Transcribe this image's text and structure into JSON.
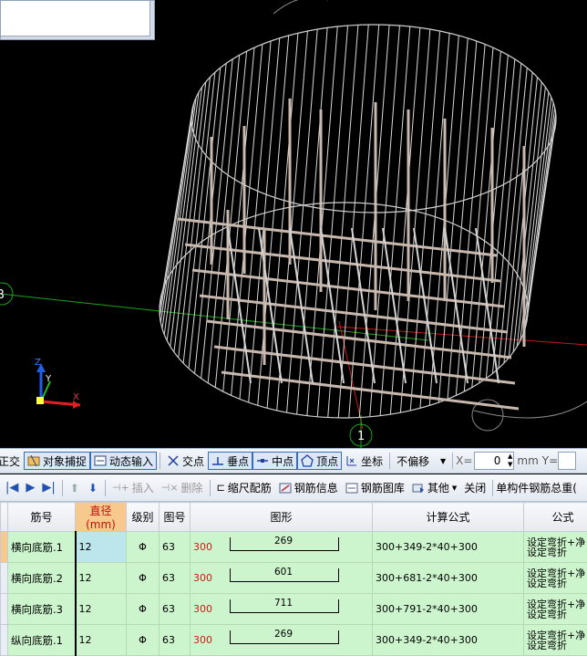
{
  "viewport": {
    "axis_labels": {
      "b": "B",
      "one": "1",
      "x": "X",
      "y": "Y",
      "z": "Z"
    },
    "colors": {
      "background": "#000000",
      "rebar": "#c8b8ae",
      "mesh": "#d4d4d4",
      "axis_green": "#1aa51a",
      "axis_red": "#c81818"
    }
  },
  "toolbar1": {
    "cut_label": "正交",
    "snap_label": "对象捕捉",
    "dynamic_label": "动态输入",
    "intersection_label": "交点",
    "perpendicular_label": "垂点",
    "midpoint_label": "中点",
    "vertex_label": "顶点",
    "coord_label": "坐标",
    "offset_select": "不偏移",
    "x_label": "X=",
    "x_value": "0",
    "unit_label": "mm",
    "y_label": "Y="
  },
  "toolbar2": {
    "insert_label": "插入",
    "delete_label": "删除",
    "scale_label": "缩尺配筋",
    "info_label": "钢筋信息",
    "library_label": "钢筋图库",
    "other_label": "其他",
    "close_label": "关闭",
    "summary_label": "单构件钢筋总重("
  },
  "grid": {
    "headers": [
      "筋号",
      "直径(mm)",
      "级别",
      "图号",
      "图形",
      "计算公式",
      "公式"
    ],
    "rows": [
      {
        "name": "横向底筋.1",
        "diameter": "12",
        "grade": "Φ",
        "fig": "63",
        "left": "300",
        "length": "269",
        "formula": "300+349-2*40+300",
        "desc1": "设定弯折+净",
        "desc2": "设定弯折"
      },
      {
        "name": "横向底筋.2",
        "diameter": "12",
        "grade": "Φ",
        "fig": "63",
        "left": "300",
        "length": "601",
        "formula": "300+681-2*40+300",
        "desc1": "设定弯折+净",
        "desc2": "设定弯折"
      },
      {
        "name": "横向底筋.3",
        "diameter": "12",
        "grade": "Φ",
        "fig": "63",
        "left": "300",
        "length": "711",
        "formula": "300+791-2*40+300",
        "desc1": "设定弯折+净",
        "desc2": "设定弯折"
      },
      {
        "name": "纵向底筋.1",
        "diameter": "12",
        "grade": "Φ",
        "fig": "63",
        "left": "300",
        "length": "269",
        "formula": "300+349-2*40+300",
        "desc1": "设定弯折+净",
        "desc2": "设定弯折"
      }
    ]
  }
}
